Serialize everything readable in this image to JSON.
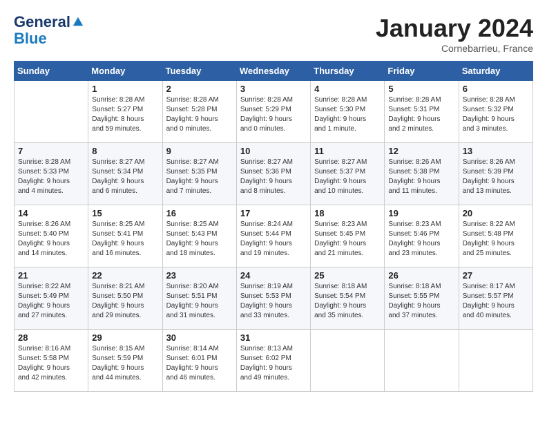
{
  "header": {
    "logo_line1": "General",
    "logo_line2": "Blue",
    "month": "January 2024",
    "location": "Cornebarrieu, France"
  },
  "weekdays": [
    "Sunday",
    "Monday",
    "Tuesday",
    "Wednesday",
    "Thursday",
    "Friday",
    "Saturday"
  ],
  "weeks": [
    [
      {
        "day": "",
        "info": ""
      },
      {
        "day": "1",
        "info": "Sunrise: 8:28 AM\nSunset: 5:27 PM\nDaylight: 8 hours\nand 59 minutes."
      },
      {
        "day": "2",
        "info": "Sunrise: 8:28 AM\nSunset: 5:28 PM\nDaylight: 9 hours\nand 0 minutes."
      },
      {
        "day": "3",
        "info": "Sunrise: 8:28 AM\nSunset: 5:29 PM\nDaylight: 9 hours\nand 0 minutes."
      },
      {
        "day": "4",
        "info": "Sunrise: 8:28 AM\nSunset: 5:30 PM\nDaylight: 9 hours\nand 1 minute."
      },
      {
        "day": "5",
        "info": "Sunrise: 8:28 AM\nSunset: 5:31 PM\nDaylight: 9 hours\nand 2 minutes."
      },
      {
        "day": "6",
        "info": "Sunrise: 8:28 AM\nSunset: 5:32 PM\nDaylight: 9 hours\nand 3 minutes."
      }
    ],
    [
      {
        "day": "7",
        "info": "Sunrise: 8:28 AM\nSunset: 5:33 PM\nDaylight: 9 hours\nand 4 minutes."
      },
      {
        "day": "8",
        "info": "Sunrise: 8:27 AM\nSunset: 5:34 PM\nDaylight: 9 hours\nand 6 minutes."
      },
      {
        "day": "9",
        "info": "Sunrise: 8:27 AM\nSunset: 5:35 PM\nDaylight: 9 hours\nand 7 minutes."
      },
      {
        "day": "10",
        "info": "Sunrise: 8:27 AM\nSunset: 5:36 PM\nDaylight: 9 hours\nand 8 minutes."
      },
      {
        "day": "11",
        "info": "Sunrise: 8:27 AM\nSunset: 5:37 PM\nDaylight: 9 hours\nand 10 minutes."
      },
      {
        "day": "12",
        "info": "Sunrise: 8:26 AM\nSunset: 5:38 PM\nDaylight: 9 hours\nand 11 minutes."
      },
      {
        "day": "13",
        "info": "Sunrise: 8:26 AM\nSunset: 5:39 PM\nDaylight: 9 hours\nand 13 minutes."
      }
    ],
    [
      {
        "day": "14",
        "info": "Sunrise: 8:26 AM\nSunset: 5:40 PM\nDaylight: 9 hours\nand 14 minutes."
      },
      {
        "day": "15",
        "info": "Sunrise: 8:25 AM\nSunset: 5:41 PM\nDaylight: 9 hours\nand 16 minutes."
      },
      {
        "day": "16",
        "info": "Sunrise: 8:25 AM\nSunset: 5:43 PM\nDaylight: 9 hours\nand 18 minutes."
      },
      {
        "day": "17",
        "info": "Sunrise: 8:24 AM\nSunset: 5:44 PM\nDaylight: 9 hours\nand 19 minutes."
      },
      {
        "day": "18",
        "info": "Sunrise: 8:23 AM\nSunset: 5:45 PM\nDaylight: 9 hours\nand 21 minutes."
      },
      {
        "day": "19",
        "info": "Sunrise: 8:23 AM\nSunset: 5:46 PM\nDaylight: 9 hours\nand 23 minutes."
      },
      {
        "day": "20",
        "info": "Sunrise: 8:22 AM\nSunset: 5:48 PM\nDaylight: 9 hours\nand 25 minutes."
      }
    ],
    [
      {
        "day": "21",
        "info": "Sunrise: 8:22 AM\nSunset: 5:49 PM\nDaylight: 9 hours\nand 27 minutes."
      },
      {
        "day": "22",
        "info": "Sunrise: 8:21 AM\nSunset: 5:50 PM\nDaylight: 9 hours\nand 29 minutes."
      },
      {
        "day": "23",
        "info": "Sunrise: 8:20 AM\nSunset: 5:51 PM\nDaylight: 9 hours\nand 31 minutes."
      },
      {
        "day": "24",
        "info": "Sunrise: 8:19 AM\nSunset: 5:53 PM\nDaylight: 9 hours\nand 33 minutes."
      },
      {
        "day": "25",
        "info": "Sunrise: 8:18 AM\nSunset: 5:54 PM\nDaylight: 9 hours\nand 35 minutes."
      },
      {
        "day": "26",
        "info": "Sunrise: 8:18 AM\nSunset: 5:55 PM\nDaylight: 9 hours\nand 37 minutes."
      },
      {
        "day": "27",
        "info": "Sunrise: 8:17 AM\nSunset: 5:57 PM\nDaylight: 9 hours\nand 40 minutes."
      }
    ],
    [
      {
        "day": "28",
        "info": "Sunrise: 8:16 AM\nSunset: 5:58 PM\nDaylight: 9 hours\nand 42 minutes."
      },
      {
        "day": "29",
        "info": "Sunrise: 8:15 AM\nSunset: 5:59 PM\nDaylight: 9 hours\nand 44 minutes."
      },
      {
        "day": "30",
        "info": "Sunrise: 8:14 AM\nSunset: 6:01 PM\nDaylight: 9 hours\nand 46 minutes."
      },
      {
        "day": "31",
        "info": "Sunrise: 8:13 AM\nSunset: 6:02 PM\nDaylight: 9 hours\nand 49 minutes."
      },
      {
        "day": "",
        "info": ""
      },
      {
        "day": "",
        "info": ""
      },
      {
        "day": "",
        "info": ""
      }
    ]
  ]
}
